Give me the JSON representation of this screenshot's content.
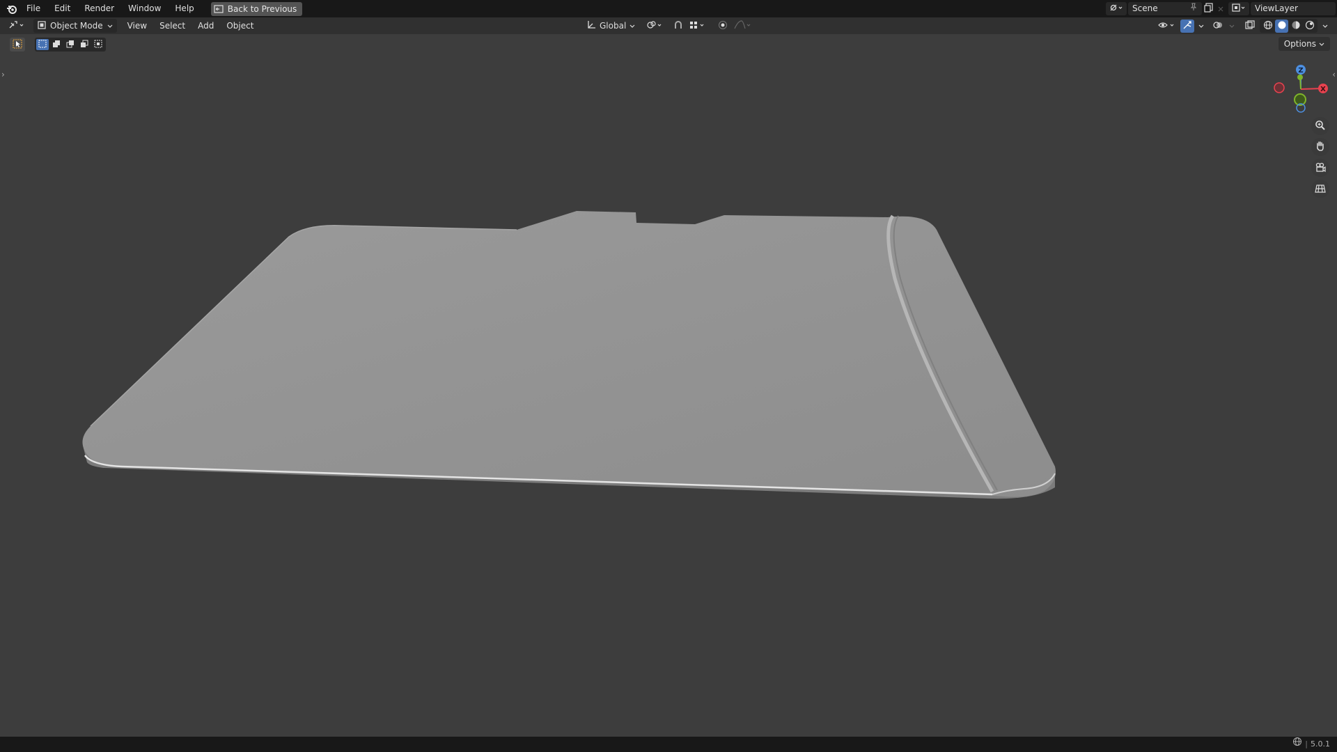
{
  "topbar": {
    "menus": [
      "File",
      "Edit",
      "Render",
      "Window",
      "Help"
    ],
    "back_label": "Back to Previous",
    "scene_label": "Scene",
    "viewlayer_label": "ViewLayer"
  },
  "header": {
    "mode_label": "Object Mode",
    "menus": [
      "View",
      "Select",
      "Add",
      "Object"
    ],
    "orientation_label": "Global"
  },
  "viewport": {
    "options_label": "Options",
    "gizmo": {
      "z_label": "Z",
      "x_label": "X",
      "y_label": "Y"
    }
  },
  "statusbar": {
    "version": "5.0.1"
  },
  "colors": {
    "accent": "#4772b3",
    "axis_x": "#e8424f",
    "axis_y": "#7fb52b",
    "axis_z": "#4d8fe0",
    "background": "#3d3d3d"
  },
  "icons": [
    "blender-logo-icon",
    "back-icon",
    "editor-type-icon",
    "mode-icon",
    "transform-orientation-icon",
    "pivot-icon",
    "snap-icon",
    "proportional-icon",
    "visibility-icon",
    "gizmo-icon",
    "overlay-icon",
    "xray-icon",
    "wireframe-shading-icon",
    "solid-shading-icon",
    "material-shading-icon",
    "rendered-shading-icon",
    "zoom-icon",
    "hand-pan-icon",
    "camera-icon",
    "grid-ortho-icon",
    "globe-icon"
  ]
}
